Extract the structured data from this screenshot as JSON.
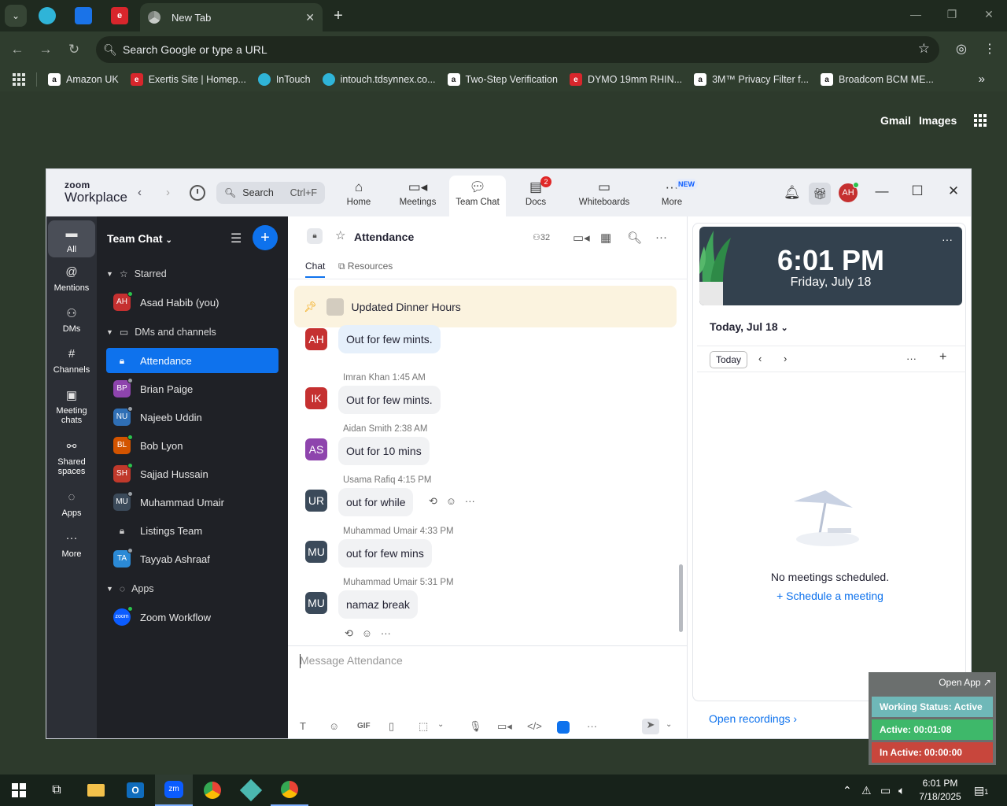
{
  "browser": {
    "active_tab_title": "New Tab",
    "omnibox_placeholder": "Search Google or type a URL",
    "bookmarks": [
      {
        "label": "Amazon UK",
        "icon": "amazon-icon"
      },
      {
        "label": "Exertis Site | Homep...",
        "icon": "exertis-icon"
      },
      {
        "label": "InTouch",
        "icon": "intouch-icon"
      },
      {
        "label": "intouch.tdsynnex.co...",
        "icon": "intouch-icon"
      },
      {
        "label": "Two-Step Verification",
        "icon": "amazon-icon"
      },
      {
        "label": "DYMO 19mm RHIN...",
        "icon": "exertis-icon"
      },
      {
        "label": "3M™ Privacy Filter f...",
        "icon": "amazon-icon"
      },
      {
        "label": "Broadcom BCM ME...",
        "icon": "amazon-icon"
      }
    ],
    "ntp_links": {
      "gmail": "Gmail",
      "images": "Images"
    }
  },
  "zoom": {
    "logo_top": "zoom",
    "logo_bottom": "Workplace",
    "search_label": "Search",
    "search_shortcut": "Ctrl+F",
    "nav_tabs": [
      {
        "label": "Home",
        "icon": "home-icon"
      },
      {
        "label": "Meetings",
        "icon": "video-icon"
      },
      {
        "label": "Team Chat",
        "icon": "chat-icon",
        "active": true
      },
      {
        "label": "Docs",
        "icon": "docs-icon",
        "badge": "2"
      },
      {
        "label": "Whiteboards",
        "icon": "whiteboard-icon"
      },
      {
        "label": "More",
        "icon": "more-icon",
        "badge": "NEW"
      }
    ],
    "user_initials": "AH",
    "rail": [
      {
        "label": "All",
        "icon": "chat-icon",
        "active": true
      },
      {
        "label": "Mentions",
        "icon": "at-icon"
      },
      {
        "label": "DMs",
        "icon": "people-icon"
      },
      {
        "label": "Channels",
        "icon": "hash-icon"
      },
      {
        "label": "Meeting chats",
        "icon": "calendar-icon"
      },
      {
        "label": "Shared spaces",
        "icon": "share-icon"
      },
      {
        "label": "Apps",
        "icon": "apps-icon"
      },
      {
        "label": "More",
        "icon": "more-icon"
      }
    ],
    "sidebar": {
      "title": "Team Chat",
      "sections": {
        "starred": "Starred",
        "dms": "DMs and channels",
        "apps": "Apps"
      },
      "starred": [
        {
          "initials": "AH",
          "name": "Asad Habib (you)",
          "color": "#c53030",
          "presence": "#2bc24c"
        }
      ],
      "channels": [
        {
          "name": "Attendance",
          "type": "lock",
          "active": true
        },
        {
          "initials": "BP",
          "name": "Brian Paige",
          "color": "#8e44ad",
          "presence": "#9aa0a6"
        },
        {
          "initials": "NU",
          "name": "Najeeb Uddin",
          "color": "#2f6fb5",
          "presence": "#9aa0a6"
        },
        {
          "initials": "BL",
          "name": "Bob Lyon",
          "color": "#d35400",
          "presence": "#2bc24c"
        },
        {
          "initials": "SH",
          "name": "Sajjad Hussain",
          "color": "#c0392b",
          "presence": "#2bc24c"
        },
        {
          "initials": "MU",
          "name": "Muhammad Umair",
          "color": "#3b4a5a",
          "presence": "#9aa0a6"
        },
        {
          "name": "Listings Team",
          "type": "lock"
        },
        {
          "initials": "TA",
          "name": "Tayyab Ashraaf",
          "color": "#2b8ad6",
          "presence": "#9aa0a6"
        }
      ],
      "apps": [
        {
          "initials": "zoom",
          "name": "Zoom Workflow",
          "color": "#0b5cff",
          "presence": "#2bc24c"
        }
      ]
    },
    "chat": {
      "channel_name": "Attendance",
      "member_count": "32",
      "tabs": [
        "Chat",
        "Resources"
      ],
      "pinned": "Updated Dinner Hours",
      "messages": [
        {
          "initials": "AH",
          "color": "#c53030",
          "sender": "",
          "time": "",
          "text": "Out for few mints."
        },
        {
          "initials": "IK",
          "color": "#c53030",
          "sender": "Imran Khan",
          "time": "1:45 AM",
          "text": "Out for few mints."
        },
        {
          "initials": "AS",
          "color": "#8e44ad",
          "sender": "Aidan Smith",
          "time": "2:38 AM",
          "text": "Out for 10 mins"
        },
        {
          "initials": "UR",
          "color": "#3b4a5a",
          "sender": "Usama Rafiq",
          "time": "4:15 PM",
          "text": "out for while"
        },
        {
          "initials": "MU",
          "color": "#3b4a5a",
          "sender": "Muhammad Umair",
          "time": "4:33 PM",
          "text": "out for few mins"
        },
        {
          "initials": "MU",
          "color": "#3b4a5a",
          "sender": "Muhammad Umair",
          "time": "5:31 PM",
          "text": "namaz break"
        }
      ],
      "composer_placeholder": "Message Attendance"
    },
    "calendar": {
      "time": "6:01 PM",
      "date": "Friday, July 18",
      "date_header": "Today, Jul 18",
      "today_button": "Today",
      "empty_text": "No meetings scheduled.",
      "schedule_link": "Schedule a meeting",
      "open_recordings": "Open recordings"
    }
  },
  "status_widget": {
    "open_app": "Open App ↗",
    "working": "Working Status: Active",
    "active": "Active: 00:01:08",
    "inactive": "In Active: 00:00:00"
  },
  "taskbar": {
    "time": "6:01 PM",
    "date": "7/18/2025",
    "notification_count": "1"
  },
  "colors": {
    "zoom_blue": "#0e72ed",
    "active_green": "#2bc24c",
    "status_teal": "#6fb8b8",
    "status_green": "#3eb86a",
    "status_red": "#c8463c"
  }
}
